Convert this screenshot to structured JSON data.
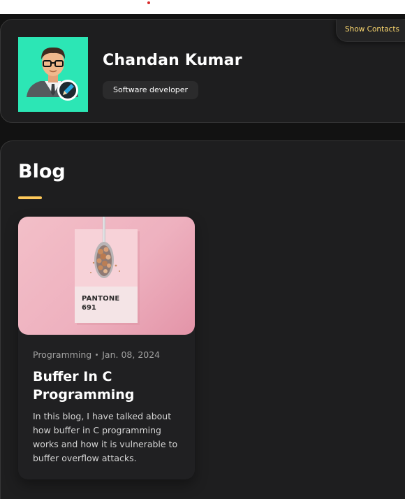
{
  "profile": {
    "name": "Chandan Kumar",
    "title": "Software developer",
    "show_contacts_label": "Show Contacts",
    "avatar_bg": "#2ce6b5"
  },
  "blog": {
    "heading": "Blog",
    "accent": "#ffc95a",
    "posts": [
      {
        "category": "Programming",
        "date": "Jan. 08, 2024",
        "title": "Buffer In C Programming",
        "excerpt": "In this blog, I have talked about how buffer in C programming works and how it is vulnerable to buffer overflow attacks.",
        "image": {
          "brand": "PANTONE",
          "code": "691"
        }
      }
    ]
  },
  "icons": {
    "avatar": "person-avatar-icon",
    "edit": "pencil-edit-icon"
  }
}
